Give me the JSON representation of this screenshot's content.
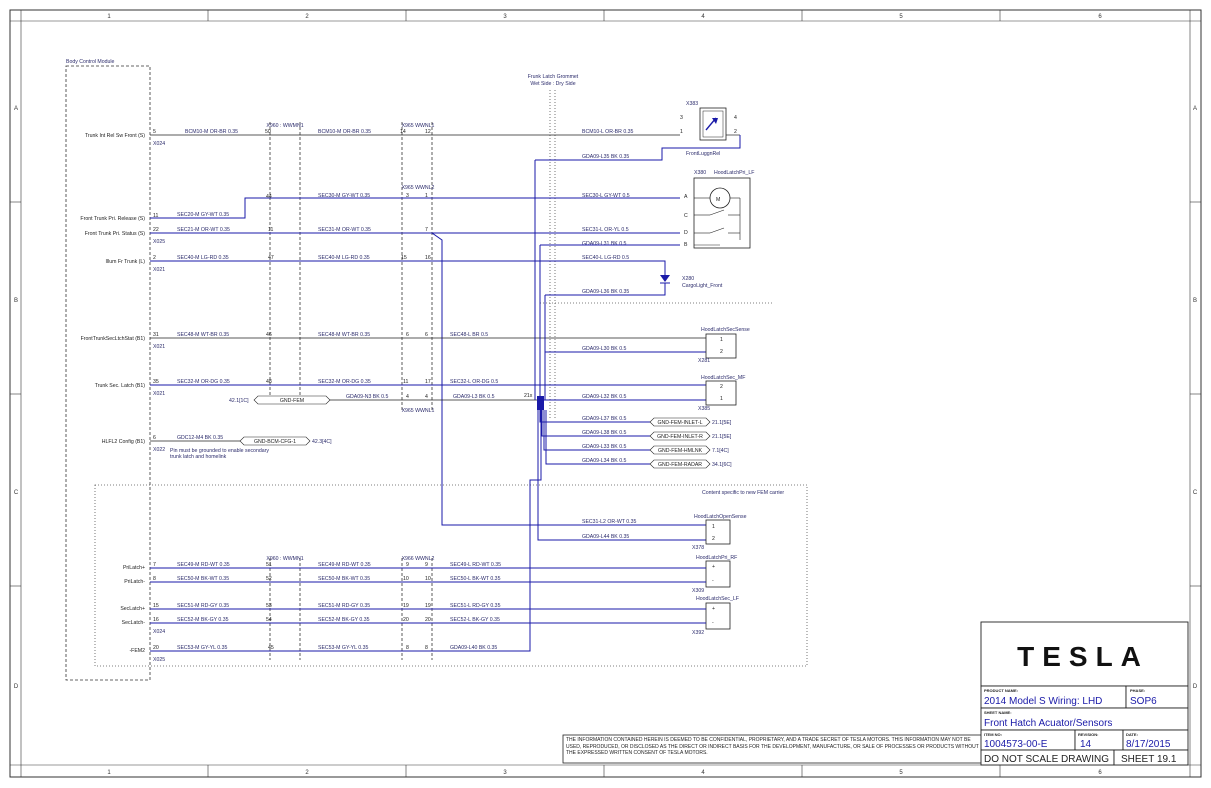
{
  "grid": {
    "cols": [
      "1",
      "2",
      "3",
      "4",
      "5",
      "6"
    ],
    "rows": [
      "A",
      "B",
      "C",
      "D"
    ]
  },
  "bcm": {
    "title": "Body Control Module",
    "pins": [
      {
        "label": "Trunk Int Rel Sw Front (S)",
        "pin": "5",
        "conn": "X024",
        "wire": "BCM10-M OR-BR 0.35"
      },
      {
        "label": "Front Trunk Pri. Release (S)",
        "pin": "11",
        "conn": "",
        "wire": "SEC20-M GY-WT 0.35"
      },
      {
        "label": "Front Trunk Pri. Status (S)",
        "pin": "22",
        "conn": "X025",
        "wire": "SEC21-M OR-WT 0.35"
      },
      {
        "label": "Illum Fr Trunk (L)",
        "pin": "2",
        "conn": "X021",
        "wire": "SEC40-M LG-RD 0.35"
      },
      {
        "label": "FrontTrunkSecLtchStat (B1)",
        "pin": "31",
        "conn": "X021",
        "wire": "SEC48-M WT-BR 0.35"
      },
      {
        "label": "Trunk Sec. Latch (B1)",
        "pin": "35",
        "conn": "X021",
        "wire": "SEC32-M OR-DG 0.35"
      },
      {
        "label": "HLFL2 Config (B1)",
        "pin": "6",
        "conn": "X022",
        "wire": "GDC12-M4 BK 0.35"
      }
    ],
    "lower_pins": [
      {
        "label": "PriLatch+",
        "pin": "7",
        "wire": "SEC49-M RD-WT 0.35"
      },
      {
        "label": "PriLatch-",
        "pin": "8",
        "wire": "SEC50-M BK-WT 0.35"
      },
      {
        "label": "SecLatch+",
        "pin": "15",
        "wire": "SEC51-M RD-GY 0.35"
      },
      {
        "label": "SecLatch-",
        "pin": "16",
        "wire": "SEC52-M BK-GY 0.35"
      },
      {
        "label": "-FEM2",
        "pin": "20",
        "wire": "SEC53-M GY-YL 0.35"
      }
    ],
    "lower_conns": [
      "X024",
      "X025"
    ],
    "ground_note": "Pin must be grounded to enable secondary trunk latch and homelink",
    "gnd_cfg": "GND-BCM-CFG-1",
    "gnd_cfg_ref": "42.3[4C]"
  },
  "inline1": {
    "name": "X960 : WWMN1",
    "lower_name": "X960 : WWMN1",
    "pins_upper": [
      "50",
      "44",
      "11",
      "47",
      "46",
      "48"
    ],
    "pins_lower": [
      "51",
      "52",
      "53",
      "54",
      "45"
    ],
    "wires_upper": [
      "BCM10-M OR-BR 0.35",
      "SEC30-M GY-WT 0.35",
      "SEC31-M OR-WT 0.35",
      "SEC40-M LG-RD 0.35",
      "SEC48-M WT-BR 0.35",
      "SEC32-M OR-DG 0.35"
    ],
    "wires_lower": [
      "SEC49-M RD-WT 0.35",
      "SEC50-M BK-WT 0.35",
      "SEC51-M RD-GY 0.35",
      "SEC52-M BK-GY 0.35",
      "SEC53-M GY-YL 0.35"
    ]
  },
  "inline2": {
    "name_a": "X965 WWNL1",
    "name_b": "X965 WWNL2",
    "name_c": "X965 WWNL1",
    "name_d": "X966 WWNL2",
    "pins_upper": [
      [
        "14",
        "12"
      ],
      [
        "3",
        "1"
      ],
      [
        "7",
        ""
      ],
      [
        "15",
        "16"
      ],
      [
        "6",
        "6"
      ],
      [
        "11",
        "17"
      ],
      [
        "4",
        "4"
      ]
    ],
    "pins_lower": [
      [
        "9",
        "9"
      ],
      [
        "10",
        "10"
      ],
      [
        "19",
        "19"
      ],
      [
        "20",
        "20"
      ],
      [
        "8",
        "8"
      ]
    ],
    "gnd_wire": "GDA09-N3 BK 0.5",
    "gnd_label": "GND-FEM",
    "gnd_ref": "42.1[1C]"
  },
  "grommet": {
    "title": "Frunk Latch Grommet",
    "subtitle": "Wet Side : Dry Side"
  },
  "right_wires": [
    "BCM10-L OR-BR 0.35",
    "GDA09-L35 BK 0.35",
    "SEC30-L GY-WT 0.5",
    "SEC31-L OR-YL 0.5",
    "GDA09-L31 BK 0.5",
    "SEC40-L LG-RD 0.5",
    "GDA09-L36 BK 0.35",
    "SEC48-L BR 0.5",
    "GDA09-L30 BK 0.5",
    "SEC32-L OR-DG 0.5",
    "GDA09-L3 BK 0.5",
    "GDA09-L32 BK 0.5",
    "GDA09-L37 BK 0.5",
    "GDA09-L38 BK 0.5",
    "GDA09-L33 BK 0.5",
    "GDA09-L34 BK 0.5",
    "SEC31-L2 OR-WT 0.35",
    "GDA09-L44 BK 0.35",
    "SEC49-L RD-WT 0.35",
    "SEC50-L BK-WT 0.35",
    "SEC51-L RD-GY 0.35",
    "SEC52-L BK-GY 0.35",
    "GDA09-L40 BK 0.35"
  ],
  "splice": "21x",
  "grounds": [
    {
      "label": "GND-FEM-INLET-L",
      "ref": "21.1[5E]"
    },
    {
      "label": "GND-FEM-INLET-R",
      "ref": "21.1[5E]"
    },
    {
      "label": "GND-FEM-HMLNK",
      "ref": "7.1[4C]"
    },
    {
      "label": "GND-FEM-RADAR",
      "ref": "34.1[6C]"
    }
  ],
  "components": {
    "x383": {
      "name": "X383",
      "sub": "FrontLuggnRel",
      "pins": [
        "3",
        "4",
        "1",
        "2"
      ]
    },
    "x380": {
      "name": "X380",
      "sub": "HoodLatchPri_LF",
      "pins": [
        "A",
        "C",
        "D",
        "B"
      ]
    },
    "x280": {
      "name": "X280",
      "sub": "CargoLight_Front"
    },
    "x281": {
      "name": "X281",
      "sub": "HoodLatchSecSense",
      "pins": [
        "1",
        "2"
      ]
    },
    "x385": {
      "name": "X385",
      "sub": "HoodLatchSec_MF",
      "pins": [
        "2",
        "1"
      ]
    },
    "x378": {
      "name": "X378",
      "sub": "HoodLatchOpenSense",
      "pins": [
        "1",
        "2"
      ]
    },
    "x309": {
      "name": "X309",
      "sub": "HoodLatchPri_RF",
      "pins": [
        "+",
        "-"
      ]
    },
    "x392": {
      "name": "X392",
      "sub": "HoodLatchSec_LF",
      "pins": [
        "+",
        "-"
      ]
    }
  },
  "fem_note": "Content specific to new FEM carrier",
  "confidential": "THE INFORMATION CONTAINED HEREIN IS DEEMED TO BE CONFIDENTIAL, PROPRIETARY, AND A TRADE SECRET OF TESLA MOTORS. THIS INFORMATION MAY NOT BE USED, REPRODUCED, OR DISCLOSED AS THE DIRECT OR INDIRECT BASIS FOR THE DEVELOPMENT, MANUFACTURE, OR SALE OF PROCESSES OR PRODUCTS WITHOUT THE EXPRESSED WRITTEN CONSENT OF TESLA MOTORS.",
  "title_block": {
    "logo": "TESLA",
    "product_label": "PRODUCT NAME:",
    "product": "2014 Model S Wiring: LHD",
    "phase_label": "PHASE:",
    "phase": "SOP6",
    "sheet_name_label": "SHEET NAME:",
    "sheet_name": "Front Hatch Acuator/Sensors",
    "item_label": "ITEM NO:",
    "item": "1004573-00-E",
    "rev_label": "REVISION:",
    "rev": "14",
    "date_label": "DATE:",
    "date": "8/17/2015",
    "noscale": "DO NOT SCALE DRAWING",
    "sheet": "SHEET 19.1"
  }
}
